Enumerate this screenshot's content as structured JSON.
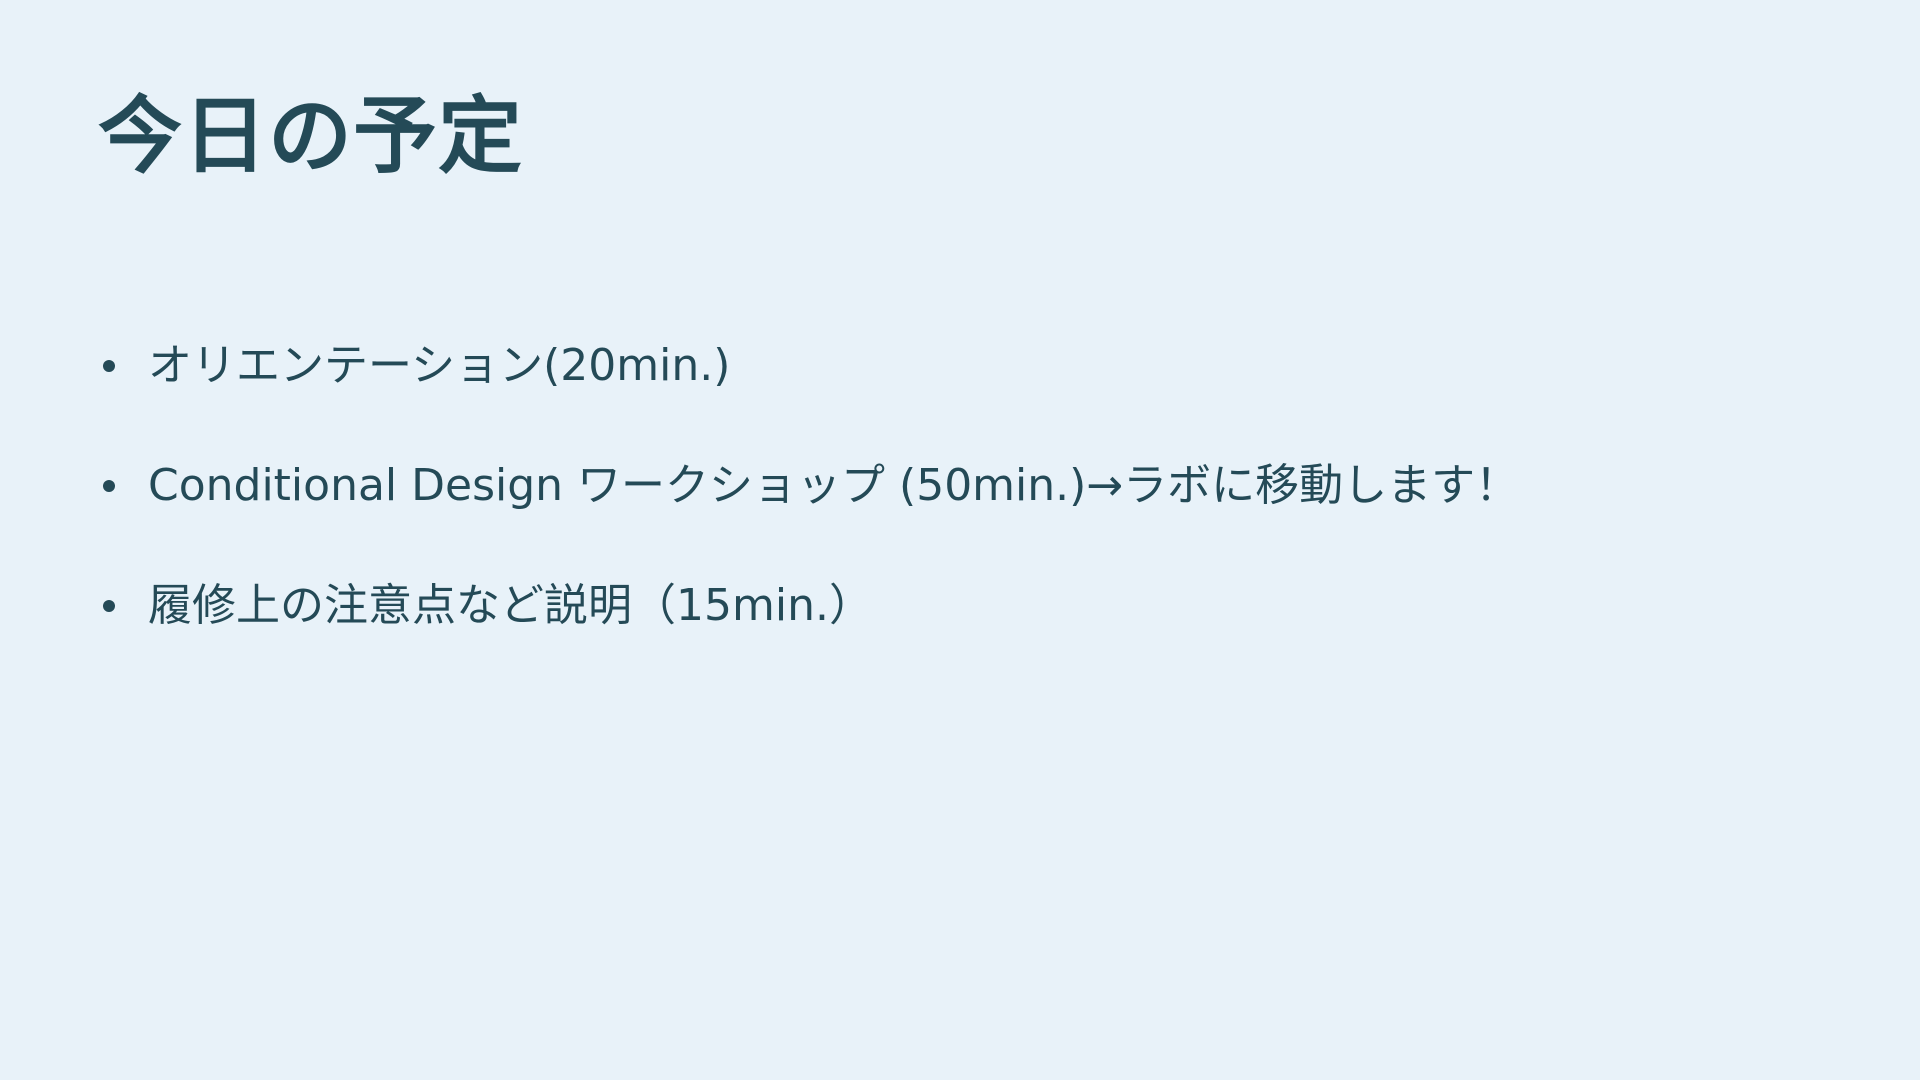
{
  "slide": {
    "title": "今日の予定",
    "items": [
      {
        "text": "オリエンテーション(20min.)"
      },
      {
        "text": "Conditional Design ワークショップ (50min.)→ラボに移動します！"
      },
      {
        "text": "履修上の注意点など説明（15min.）"
      }
    ]
  },
  "colors": {
    "background": "#e8f2f9",
    "text": "#244a57"
  },
  "icons": {
    "bullet": "bullet-dot-icon"
  }
}
